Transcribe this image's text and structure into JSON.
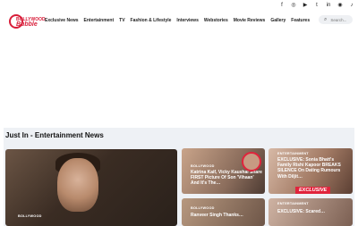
{
  "social": [
    "f",
    "◎",
    "▶",
    "t",
    "in",
    "◉",
    "♪"
  ],
  "logo": {
    "line1": "BOLLYWOOD",
    "line2": "Bubble"
  },
  "nav": {
    "items": [
      "Exclusive News",
      "Entertainment",
      "TV",
      "Fashion & Lifestyle",
      "Interviews",
      "Webstories",
      "Movie Reviews",
      "Gallery",
      "Features"
    ]
  },
  "search": {
    "placeholder": "Search..."
  },
  "section": {
    "title": "Just In - Entertainment News"
  },
  "cards": [
    {
      "category": "BOLLYWOOD",
      "headline": ""
    },
    {
      "category": "BOLLYWOOD",
      "headline": "Katrina Kaif, Vicky Kaushal Share FIRST Picture Of Son 'Vihaan' And It's The…"
    },
    {
      "category": "ENTERTAINMENT",
      "headline": "EXCLUSIVE: Sonia Bhatt's Family Rishi Kapoor BREAKS SILENCE On Dating Rumours With Diljit…"
    },
    {
      "category": "BOLLYWOOD",
      "headline": "Ranveer Singh Thanks…"
    },
    {
      "category": "ENTERTAINMENT",
      "headline": "EXCLUSIVE: Scared…"
    }
  ],
  "badge": {
    "label": "EXCLUSIVE"
  }
}
